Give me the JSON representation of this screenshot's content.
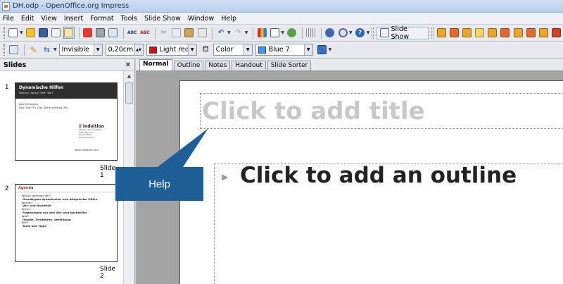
{
  "window": {
    "title": "DH.odp - OpenOffice.org Impress"
  },
  "menu": [
    "File",
    "Edit",
    "View",
    "Insert",
    "Format",
    "Tools",
    "Slide Show",
    "Window",
    "Help"
  ],
  "toolbar": {
    "slideshow_label": "Slide Show"
  },
  "line_toolbar": {
    "line_style": "Invisible",
    "line_width": "0,20cm",
    "line_color": "Light red",
    "line_color_hex": "#e00000",
    "area_style": "Color",
    "area_color": "Blue 7",
    "area_color_hex": "#3399ff"
  },
  "slides_pane": {
    "title": "Slides",
    "slides": [
      {
        "number": "1",
        "caption": "Slide 1",
        "heading": "Dynamische Hilfen",
        "subheading": "Warum? Wozu? Wie? Wo?",
        "author_line1": "Beni Achenbau",
        "author_line2": "Dipl.-Ing.(FH), Dipl.-Wirtschaftsing.(FH)",
        "brand_prefix": "ii",
        "brand_rest": " indoition",
        "brand_sub1": "Wissen, das einsetzen",
        "brand_sub2": "Informationen",
        "brand_sub3": "Online-Hilfen",
        "brand_sub4": "Dokumentation",
        "url": "www.indoition.com"
      },
      {
        "number": "2",
        "caption": "Slide 2",
        "heading": "Agenda",
        "lines": [
          "- Wovon sprechen wir?",
          "  Grundtypen dynamischer und integrierter Hilfen",
          "- Warum?",
          "  Vor- und Nachteile",
          "- Wann?",
          "  Folgerungen aus den Vor- und Nachteilen",
          "- Was?",
          "  Inhalte, Strukturen, Verlinkung",
          "- Wie?",
          "  Tools und Tipps"
        ]
      }
    ]
  },
  "tabs": [
    "Normal",
    "Outline",
    "Notes",
    "Handout",
    "Slide Sorter"
  ],
  "slide": {
    "title_placeholder": "Click to add title",
    "outline_placeholder": "Click to add an outline"
  },
  "callout": {
    "label": "Help",
    "color": "#1e5f98"
  }
}
